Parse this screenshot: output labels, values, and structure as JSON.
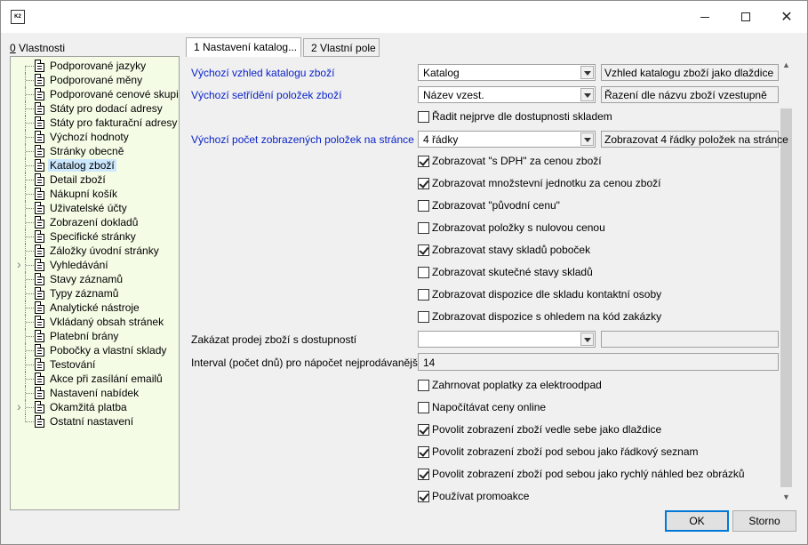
{
  "window": {
    "app_icon_text": "K2",
    "minimize": "",
    "maximize": "",
    "close": "✕"
  },
  "sidebar": {
    "title_hotkey": "0",
    "title_rest": " Vlastnosti",
    "items": [
      {
        "label": "Podporované jazyky",
        "expandable": false
      },
      {
        "label": "Podporované měny",
        "expandable": false
      },
      {
        "label": "Podporované cenové skupiny",
        "expandable": false
      },
      {
        "label": "Státy pro dodací adresy",
        "expandable": false
      },
      {
        "label": "Státy pro fakturační adresy",
        "expandable": false
      },
      {
        "label": "Výchozí hodnoty",
        "expandable": false
      },
      {
        "label": "Stránky obecně",
        "expandable": false
      },
      {
        "label": "Katalog zboží",
        "expandable": false,
        "selected": true
      },
      {
        "label": "Detail zboží",
        "expandable": false
      },
      {
        "label": "Nákupní košík",
        "expandable": false
      },
      {
        "label": "Uživatelské účty",
        "expandable": false
      },
      {
        "label": "Zobrazení dokladů",
        "expandable": false
      },
      {
        "label": "Specifické stránky",
        "expandable": false
      },
      {
        "label": "Záložky úvodní stránky",
        "expandable": false
      },
      {
        "label": "Vyhledávání",
        "expandable": true
      },
      {
        "label": "Stavy záznamů",
        "expandable": false
      },
      {
        "label": "Typy záznamů",
        "expandable": false
      },
      {
        "label": "Analytické nástroje",
        "expandable": false
      },
      {
        "label": "Vkládaný obsah stránek",
        "expandable": false
      },
      {
        "label": "Platební brány",
        "expandable": false
      },
      {
        "label": "Pobočky a vlastní sklady",
        "expandable": false
      },
      {
        "label": "Testování",
        "expandable": false
      },
      {
        "label": "Akce při zasílání emailů",
        "expandable": false
      },
      {
        "label": "Nastavení nabídek",
        "expandable": false
      },
      {
        "label": "Okamžitá platba",
        "expandable": true
      },
      {
        "label": "Ostatní nastavení",
        "expandable": false
      }
    ]
  },
  "tabs": [
    {
      "label": "1 Nastavení katalog...",
      "active": true
    },
    {
      "label": "2 Vlastní pole",
      "active": false
    }
  ],
  "form": {
    "default_view": {
      "label": "Výchozí vzhled katalogu zboží",
      "value": "Katalog",
      "description": "Vzhled katalogu zboží jako dlaždice"
    },
    "default_sort": {
      "label": "Výchozí setřídění položek zboží",
      "value": "Název vzest.",
      "description": "Řazení dle názvu zboží vzestupně"
    },
    "sort_by_stock": {
      "label": "Řadit nejprve dle dostupnosti skladem",
      "checked": false
    },
    "default_count": {
      "label": "Výchozí počet zobrazených položek na stránce",
      "value": "4 řádky",
      "description": "Zobrazovat 4 řádky položek na stránce"
    },
    "checks_a": [
      {
        "label": "Zobrazovat \"s DPH\" za cenou zboží",
        "checked": true
      },
      {
        "label": "Zobrazovat množstevní jednotku za cenou zboží",
        "checked": true
      },
      {
        "label": "Zobrazovat \"původní cenu\"",
        "checked": false
      },
      {
        "label": "Zobrazovat položky s nulovou cenou",
        "checked": false
      },
      {
        "label": "Zobrazovat stavy skladů poboček",
        "checked": true
      },
      {
        "label": "Zobrazovat skutečné stavy skladů",
        "checked": false
      },
      {
        "label": "Zobrazovat dispozice dle skladu kontaktní osoby",
        "checked": false
      },
      {
        "label": "Zobrazovat dispozice s ohledem na kód zakázky",
        "checked": false
      }
    ],
    "disable_sale": {
      "label": "Zakázat prodej zboží s dostupností",
      "value": "",
      "description": ""
    },
    "interval": {
      "label": "Interval (počet dnů) pro nápočet nejprodávanější...",
      "value": "14"
    },
    "checks_b": [
      {
        "label": "Zahrnovat poplatky za elektroodpad",
        "checked": false
      },
      {
        "label": "Napočítávat ceny online",
        "checked": false
      },
      {
        "label": "Povolit zobrazení zboží vedle sebe jako dlaždice",
        "checked": true
      },
      {
        "label": "Povolit zobrazení zboží pod sebou jako řádkový seznam",
        "checked": true
      },
      {
        "label": "Povolit zobrazení zboží pod sebou jako rychlý náhled bez obrázků",
        "checked": true
      },
      {
        "label": "Používat promoakce",
        "checked": true
      }
    ]
  },
  "buttons": {
    "ok": "OK",
    "cancel": "Storno"
  }
}
